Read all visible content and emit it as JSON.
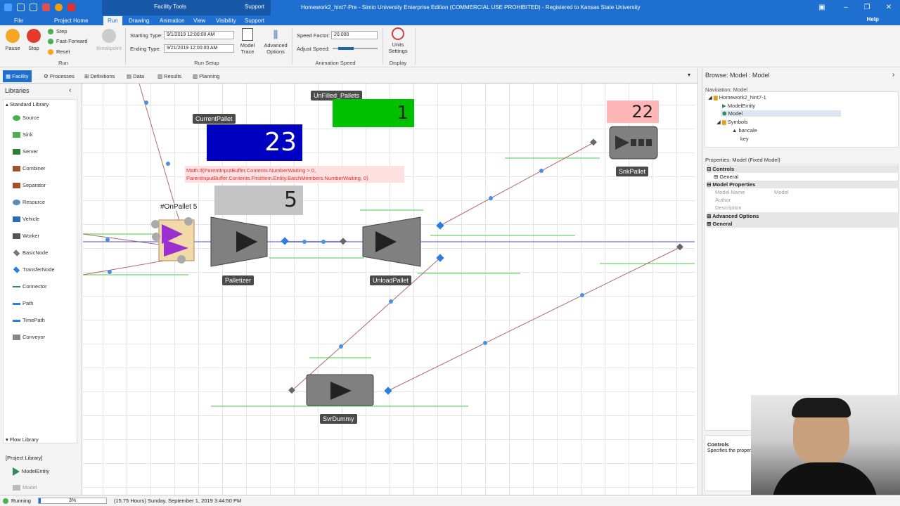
{
  "window": {
    "title": "Homework2_hint7-Pre - Simio University Enterprise Edition (COMMERCIAL USE PROHIBITED) - Registered to Kansas State University",
    "context_tab": "Facility Tools",
    "support_ctx": "Support"
  },
  "ribbon_tabs": [
    "File",
    "Project Home",
    "Run",
    "Drawing",
    "Animation",
    "View",
    "Visibility",
    "Support"
  ],
  "help": "Help",
  "run_group": {
    "pause": "Pause",
    "stop": "Stop",
    "step": "Step",
    "fast_forward": "Fast-Forward",
    "reset": "Reset",
    "breakpoint": "Breakpoint",
    "label": "Run"
  },
  "run_setup": {
    "starting_type_label": "Starting Type:",
    "starting_type_value": "9/1/2019 12:00:00 AM",
    "ending_type_label": "Ending Type:",
    "ending_type_value": "9/21/2019 12:00:00 AM",
    "model_trace": "Model Trace",
    "advanced_options": "Advanced Options",
    "label": "Run Setup"
  },
  "animation_speed": {
    "speed_factor_label": "Speed Factor:",
    "speed_factor_value": "20.000",
    "adjust_speed_label": "Adjust Speed:",
    "label": "Animation Speed"
  },
  "display": {
    "units_settings": "Units Settings",
    "label": "Display"
  },
  "view_tabs": [
    "Facility",
    "Processes",
    "Definitions",
    "Data",
    "Results",
    "Planning"
  ],
  "libraries": {
    "title": "Libraries",
    "standard_library": "Standard Library",
    "items": [
      "Source",
      "Sink",
      "Server",
      "Combiner",
      "Separator",
      "Resource",
      "Vehicle",
      "Worker",
      "BasicNode",
      "TransferNode",
      "Connector",
      "Path",
      "TimePath",
      "Conveyor"
    ],
    "flow_library": "Flow Library",
    "project_library": "[Project Library]",
    "project_items": [
      "ModelEntity",
      "Model"
    ]
  },
  "canvas": {
    "unfilled_pallets_label": "UnFilled_Pallets",
    "unfilled_pallets_value": "1",
    "current_pallet_label": "CurrentPallet",
    "current_pallet_value": "23",
    "expression_line1": "Math.If(ParentInputBuffer.Contents.NumberWaiting > 0,",
    "expression_line2": "ParentInputBuffer.Contents.FirstItem.Entity.BatchMembers.NumberWaiting, 0)",
    "expression_value": "5",
    "on_pallet_label": "#OnPallet 5",
    "snk_value": "22",
    "palletizer": "Palletizer",
    "unload_pallet": "UnloadPallet",
    "svr_dummy": "SvrDummy",
    "snk_pallet": "SnkPallet"
  },
  "browse": {
    "title": "Browse: Model : Model",
    "navigation": "Navigation: Model",
    "tree": [
      "Homework2_hint7-1",
      "ModelEntity",
      "Model",
      "Symbols",
      "bancale",
      "key"
    ]
  },
  "properties": {
    "title": "Properties: Model (Fixed Model)",
    "controls": "Controls",
    "general_sub": "General",
    "model_properties": "Model Properties",
    "model_name_label": "Model Name",
    "model_name_value": "Model",
    "author": "Author",
    "description": "Description",
    "advanced_options": "Advanced Options",
    "general": "General",
    "help_title": "Controls",
    "help_text": "Specifies the proper"
  },
  "status": {
    "running": "Running",
    "progress_text": "3%",
    "progress": 0.03,
    "time": "(15.75 Hours) Sunday, September 1, 2019 3:44:50 PM"
  },
  "colors": {
    "accent": "#1e6fd0",
    "unfilled": "#00c000",
    "current": "#0000c0",
    "snk": "#ffb6b6"
  }
}
